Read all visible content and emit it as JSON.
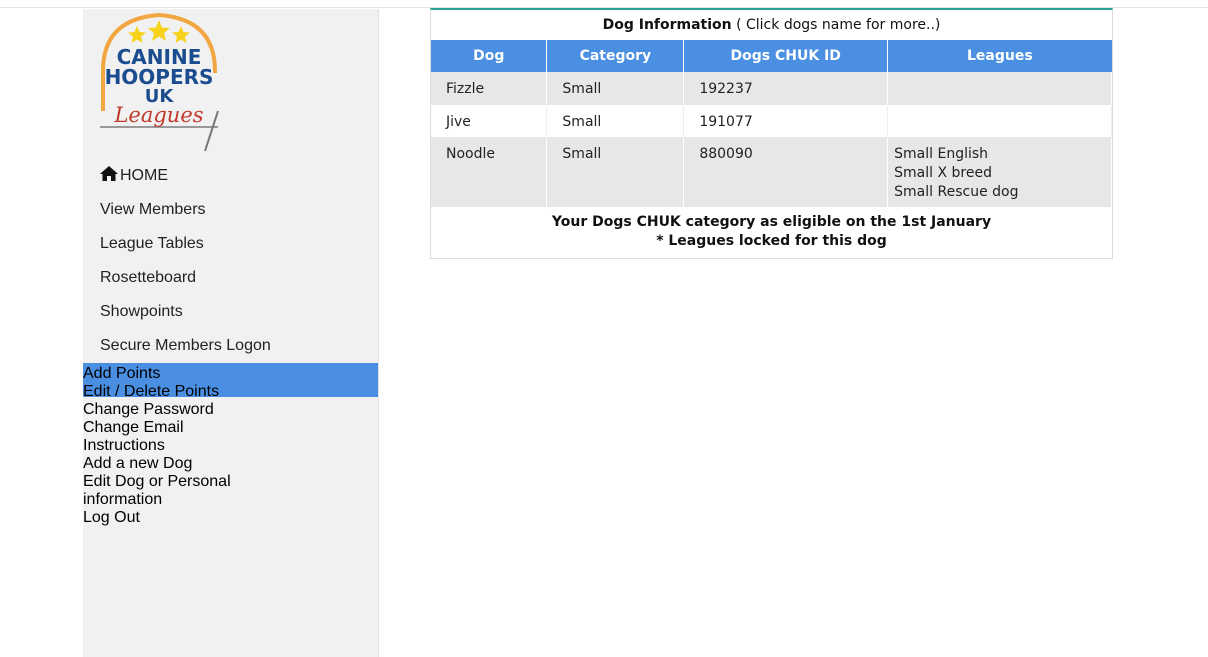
{
  "logo": {
    "line1": "CANINE",
    "line2": "HOOPERS",
    "line3": "UK",
    "line4": "Leagues",
    "colors": {
      "star": "#f7d21b",
      "text_dark": "#1a4c8f",
      "text_script": "#c0392b",
      "arc": "#f1a640"
    }
  },
  "sidebar": {
    "group1": [
      {
        "label": "HOME",
        "icon": "home-icon"
      },
      {
        "label": "View Members"
      },
      {
        "label": "League Tables"
      },
      {
        "label": "Rosetteboard"
      },
      {
        "label": "Showpoints"
      },
      {
        "label": "Secure Members Logon"
      }
    ],
    "group2": [
      {
        "label": "Add Points"
      },
      {
        "label": "Edit / Delete Points"
      },
      {
        "label": "Change Password"
      },
      {
        "label": "Change Email"
      },
      {
        "label": "Instructions"
      },
      {
        "label": "Add a new Dog"
      },
      {
        "label": "Edit Dog or Personal information"
      },
      {
        "label": "Log Out"
      }
    ],
    "accent": "#4a8fe2"
  },
  "panel": {
    "title_bold": "Dog Information",
    "title_rest": "( Click dogs name for more..)",
    "columns": [
      "Dog",
      "Category",
      "Dogs CHUK ID",
      "Leagues"
    ],
    "rows": [
      {
        "dog": "Fizzle",
        "category": "Small",
        "id": "192237",
        "leagues": []
      },
      {
        "dog": "Jive",
        "category": "Small",
        "id": "191077",
        "leagues": []
      },
      {
        "dog": "Noodle",
        "category": "Small",
        "id": "880090",
        "leagues": [
          "Small English",
          "Small X breed",
          "Small Rescue dog"
        ]
      }
    ],
    "note_line1": "Your Dogs CHUK category as eligible on the 1st January",
    "note_line2": "* Leagues locked for this dog",
    "header_color": "#4a8fe2"
  }
}
